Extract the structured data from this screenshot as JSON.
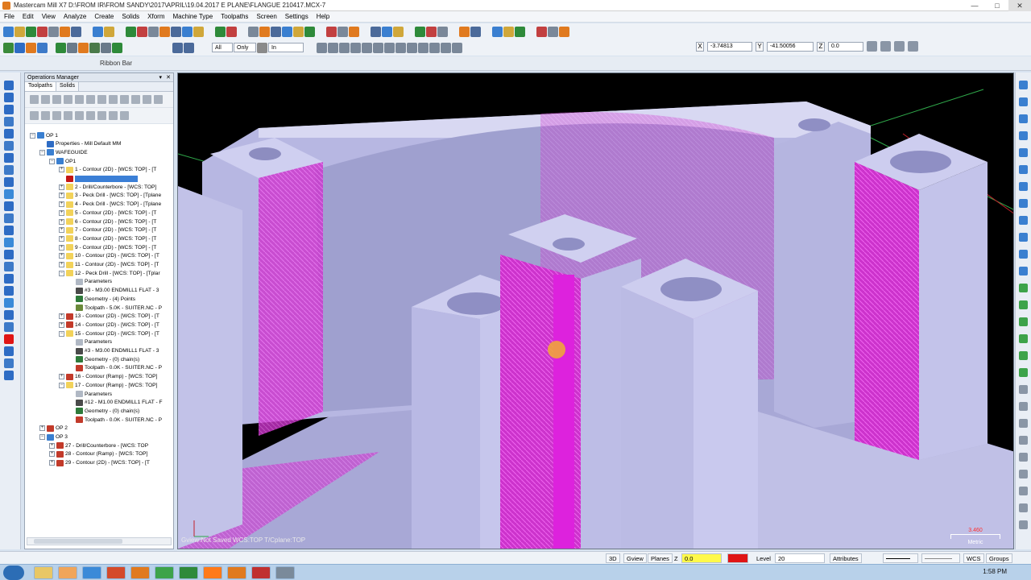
{
  "titlebar": {
    "title": "Mastercam Mill X7  D:\\FROM IR\\FROM SANDY\\2017\\APRIL\\19.04.2017 E PLANE\\FLANGUE 210417.MCX-7",
    "minimize": "—",
    "maximize": "□",
    "close": "✕"
  },
  "menu": [
    "File",
    "Edit",
    "View",
    "Analyze",
    "Create",
    "Solids",
    "Xform",
    "Machine Type",
    "Toolpaths",
    "Screen",
    "Settings",
    "Help"
  ],
  "toolbar2": {
    "all_label": "All",
    "only_label": "Only",
    "in_select": "In",
    "x_label": "X",
    "x_value": "-3.74813",
    "y_label": "Y",
    "y_value": "-41.50056",
    "z_label": "Z",
    "z_value": "0.0"
  },
  "ribbon_bar_label": "Ribbon Bar",
  "ops_manager": {
    "title": "Operations Manager",
    "tabs": [
      "Toolpaths",
      "Solids"
    ],
    "tree": [
      {
        "indent": 0,
        "exp": "−",
        "icon": "group",
        "text": "OP 1"
      },
      {
        "indent": 1,
        "exp": "",
        "icon": "props",
        "text": "Properties - Mill Default MM"
      },
      {
        "indent": 1,
        "exp": "−",
        "icon": "group",
        "text": "WAFEGUIDE"
      },
      {
        "indent": 2,
        "exp": "−",
        "icon": "group",
        "text": "OP1"
      },
      {
        "indent": 3,
        "exp": "+",
        "icon": "folder",
        "text": "1 - Contour (2D) - [WCS: TOP] - [T"
      },
      {
        "indent": 3,
        "exp": "",
        "icon": "arrow",
        "text": ""
      },
      {
        "indent": 3,
        "exp": "+",
        "icon": "folder",
        "text": "2 - Drill/Counterbore - [WCS: TOP]"
      },
      {
        "indent": 3,
        "exp": "+",
        "icon": "folder",
        "text": "3 - Peck Drill - [WCS: TOP] - [Tplane"
      },
      {
        "indent": 3,
        "exp": "+",
        "icon": "folder",
        "text": "4 - Peck Drill - [WCS: TOP] - [Tplane"
      },
      {
        "indent": 3,
        "exp": "+",
        "icon": "folder",
        "text": "5 - Contour (2D) - [WCS: TOP] - [T"
      },
      {
        "indent": 3,
        "exp": "+",
        "icon": "folder",
        "text": "6 - Contour (2D) - [WCS: TOP] - [T"
      },
      {
        "indent": 3,
        "exp": "+",
        "icon": "folder",
        "text": "7 - Contour (2D) - [WCS: TOP] - [T"
      },
      {
        "indent": 3,
        "exp": "+",
        "icon": "folder",
        "text": "8 - Contour (2D) - [WCS: TOP] - [T"
      },
      {
        "indent": 3,
        "exp": "+",
        "icon": "folder",
        "text": "9 - Contour (2D) - [WCS: TOP] - [T"
      },
      {
        "indent": 3,
        "exp": "+",
        "icon": "folder",
        "text": "10 - Contour (2D) - [WCS: TOP] - [T"
      },
      {
        "indent": 3,
        "exp": "+",
        "icon": "folder",
        "text": "11 - Contour (2D) - [WCS: TOP] - [T"
      },
      {
        "indent": 3,
        "exp": "−",
        "icon": "folder",
        "text": "12 - Peck Drill - [WCS: TOP] - [Tplar"
      },
      {
        "indent": 4,
        "exp": "",
        "icon": "params",
        "text": "Parameters"
      },
      {
        "indent": 4,
        "exp": "",
        "icon": "tool",
        "text": "#3 - M3.00 ENDMILL1 FLAT - 3"
      },
      {
        "indent": 4,
        "exp": "",
        "icon": "geom",
        "text": "Geometry - (4) Points"
      },
      {
        "indent": 4,
        "exp": "",
        "icon": "path",
        "text": "Toolpath - 5.0K - SUITER.NC - P"
      },
      {
        "indent": 3,
        "exp": "+",
        "icon": "dirty",
        "text": "13 - Contour (2D) - [WCS: TOP] - [T"
      },
      {
        "indent": 3,
        "exp": "+",
        "icon": "dirty",
        "text": "14 - Contour (2D) - [WCS: TOP] - [T"
      },
      {
        "indent": 3,
        "exp": "−",
        "icon": "folder",
        "text": "15 - Contour (2D) - [WCS: TOP] - [T"
      },
      {
        "indent": 4,
        "exp": "",
        "icon": "params",
        "text": "Parameters"
      },
      {
        "indent": 4,
        "exp": "",
        "icon": "tool",
        "text": "#3 - M3.00 ENDMILL1 FLAT - 3"
      },
      {
        "indent": 4,
        "exp": "",
        "icon": "geom",
        "text": "Geometry - (0) chain(s)"
      },
      {
        "indent": 4,
        "exp": "",
        "icon": "dirtypath",
        "text": "Toolpath - 0.0K - SUITER.NC - P"
      },
      {
        "indent": 3,
        "exp": "+",
        "icon": "dirty",
        "text": "16 - Contour (Ramp) - [WCS: TOP]"
      },
      {
        "indent": 3,
        "exp": "−",
        "icon": "folder",
        "text": "17 - Contour (Ramp) - [WCS: TOP]"
      },
      {
        "indent": 4,
        "exp": "",
        "icon": "params",
        "text": "Parameters"
      },
      {
        "indent": 4,
        "exp": "",
        "icon": "tool",
        "text": "#12 - M1.00 ENDMILL1 FLAT - F"
      },
      {
        "indent": 4,
        "exp": "",
        "icon": "geom",
        "text": "Geometry - (0) chain(s)"
      },
      {
        "indent": 4,
        "exp": "",
        "icon": "dirtypath",
        "text": "Toolpath - 0.0K - SUITER.NC - P"
      },
      {
        "indent": 1,
        "exp": "+",
        "icon": "dirty",
        "text": "OP 2"
      },
      {
        "indent": 1,
        "exp": "−",
        "icon": "group",
        "text": "OP 3"
      },
      {
        "indent": 2,
        "exp": "+",
        "icon": "dirty",
        "text": "27 - Drill/Counterbore - [WCS: TOP"
      },
      {
        "indent": 2,
        "exp": "+",
        "icon": "dirty",
        "text": "28 - Contour (Ramp) - [WCS: TOP]"
      },
      {
        "indent": 2,
        "exp": "+",
        "icon": "dirty",
        "text": "29 - Contour (2D) - [WCS: TOP] - [T"
      }
    ]
  },
  "viewport": {
    "status": "Gview:Not Saved    WCS:TOP    T/Cplane:TOP",
    "scale_value": "3.460",
    "scale_units": "Metric"
  },
  "statusbar": {
    "d3": "3D",
    "gview": "Gview",
    "planes": "Planes",
    "z_label": "Z",
    "z_value": "0.0",
    "level_label": "Level",
    "level_value": "20",
    "attributes": "Attributes",
    "wcs": "WCS",
    "groups": "Groups"
  },
  "taskbar": {
    "time": "1:58 PM"
  }
}
